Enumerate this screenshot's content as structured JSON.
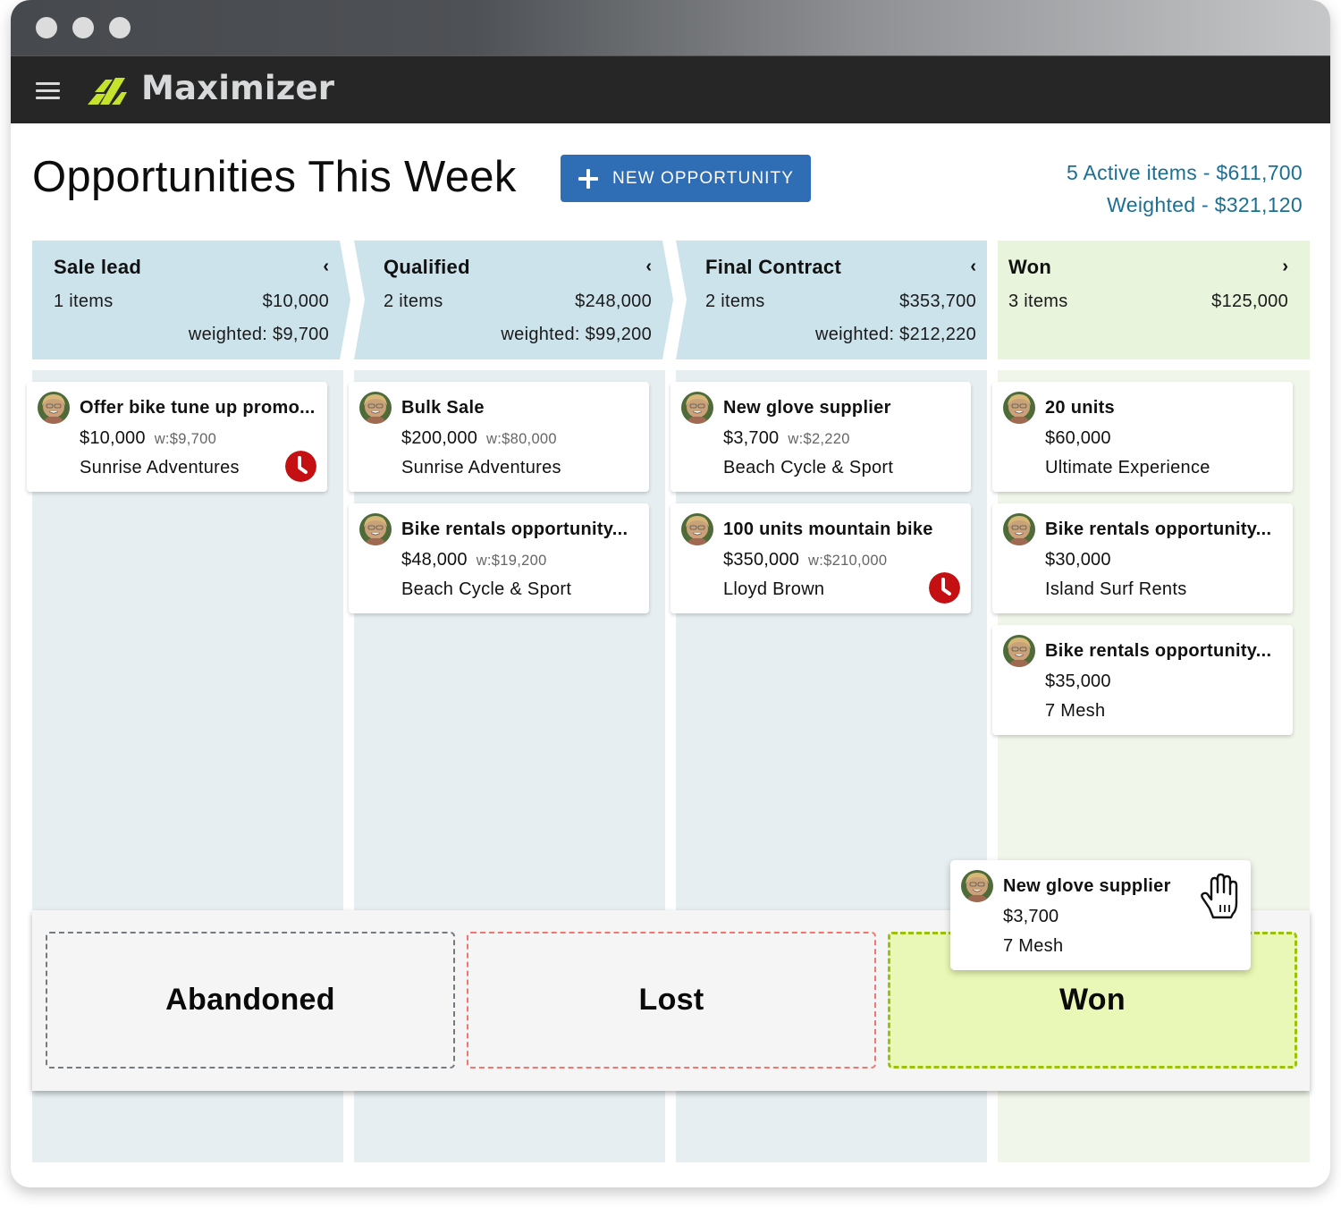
{
  "window": {
    "traffic_lights": [
      "close",
      "minimize",
      "maximize"
    ]
  },
  "appbar": {
    "menu_icon": "hamburger-menu-icon",
    "logo_icon": "maximizer-logo-icon",
    "brand": "Maximizer",
    "brand_color": "#c6e22c"
  },
  "header": {
    "title": "Opportunities This Week",
    "new_button_label": "NEW OPPORTUNITY",
    "new_button_icon": "plus-icon",
    "accent_color": "#2f6db4",
    "summary_line1": "5 Active items - $611,700",
    "summary_line2": "Weighted - $321,120",
    "summary_color": "#1c6f94"
  },
  "stages": [
    {
      "name": "Sale lead",
      "chevron": "‹",
      "count": "1 items",
      "total": "$10,000",
      "weighted": "weighted: $9,700",
      "cards": [
        {
          "title": "Offer bike tune up promo...",
          "amount": "$10,000",
          "weighted": "w:$9,700",
          "company": "Sunrise Adventures",
          "overdue": true
        }
      ]
    },
    {
      "name": "Qualified",
      "chevron": "‹",
      "count": "2 items",
      "total": "$248,000",
      "weighted": "weighted: $99,200",
      "cards": [
        {
          "title": "Bulk Sale",
          "amount": "$200,000",
          "weighted": "w:$80,000",
          "company": "Sunrise Adventures",
          "overdue": false
        },
        {
          "title": "Bike rentals opportunity...",
          "amount": "$48,000",
          "weighted": "w:$19,200",
          "company": "Beach Cycle & Sport",
          "overdue": false
        }
      ]
    },
    {
      "name": "Final Contract",
      "chevron": "‹",
      "count": "2 items",
      "total": "$353,700",
      "weighted": "weighted: $212,220",
      "cards": [
        {
          "title": "New glove supplier",
          "amount": "$3,700",
          "weighted": "w:$2,220",
          "company": "Beach Cycle & Sport",
          "overdue": false
        },
        {
          "title": "100 units mountain bike",
          "amount": "$350,000",
          "weighted": "w:$210,000",
          "company": "Lloyd Brown",
          "overdue": true
        }
      ]
    },
    {
      "name": "Won",
      "chevron": "›",
      "count": "3 items",
      "total": "$125,000",
      "weighted": "",
      "cards": [
        {
          "title": "20 units",
          "amount": "$60,000",
          "weighted": "",
          "company": "Ultimate Experience",
          "overdue": false
        },
        {
          "title": "Bike rentals opportunity...",
          "amount": "$30,000",
          "weighted": "",
          "company": "Island Surf Rents",
          "overdue": false
        },
        {
          "title": "Bike rentals opportunity...",
          "amount": "$35,000",
          "weighted": "",
          "company": "7 Mesh",
          "overdue": false
        }
      ]
    }
  ],
  "drop_zones": [
    {
      "label": "Abandoned",
      "border_color": "#737a80"
    },
    {
      "label": "Lost",
      "border_color": "#f2766f"
    },
    {
      "label": "Won",
      "border_color": "#9cc10b",
      "fill_color": "#e9f8b6"
    }
  ],
  "dragging_card": {
    "title": "New glove supplier",
    "amount": "$3,700",
    "company": "7 Mesh",
    "cursor_icon": "grab-hand-cursor-icon"
  },
  "colors": {
    "stage_header_blue": "#cde3ec",
    "stage_header_green": "#e9f4dc",
    "overdue_red": "#c40f13"
  }
}
